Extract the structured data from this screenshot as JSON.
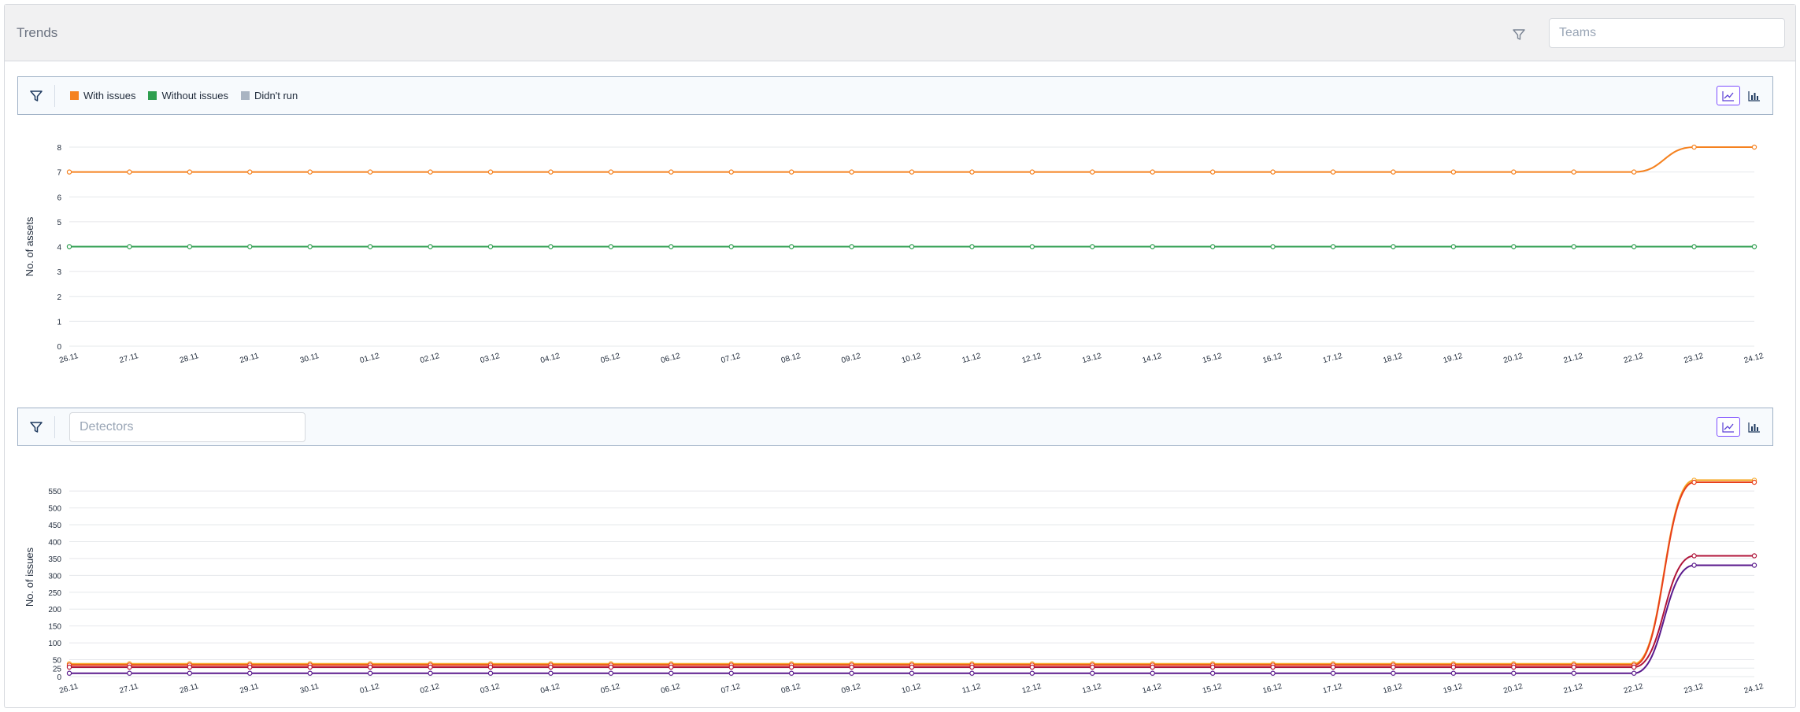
{
  "header": {
    "title": "Trends",
    "teams_placeholder": "Teams",
    "filter_icon": "filter-icon"
  },
  "assets_panel": {
    "legend": [
      {
        "label": "With issues",
        "color": "#f58220"
      },
      {
        "label": "Without issues",
        "color": "#2e9e4f"
      },
      {
        "label": "Didn't run",
        "color": "#a9b4c2"
      }
    ],
    "view_modes": [
      "line-chart-icon",
      "bar-chart-icon"
    ],
    "active_view": "line"
  },
  "issues_panel": {
    "detectors_placeholder": "Detectors",
    "view_modes": [
      "line-chart-icon",
      "bar-chart-icon"
    ],
    "active_view": "line"
  },
  "chart_data": [
    {
      "type": "line",
      "ylabel": "No. of assets",
      "xlabel": "",
      "ylim": [
        0,
        8
      ],
      "yticks": [
        0,
        1,
        2,
        3,
        4,
        5,
        6,
        7,
        8
      ],
      "grid": true,
      "categories": [
        "26.11",
        "27.11",
        "28.11",
        "29.11",
        "30.11",
        "01.12",
        "02.12",
        "03.12",
        "04.12",
        "05.12",
        "06.12",
        "07.12",
        "08.12",
        "09.12",
        "10.12",
        "11.12",
        "12.12",
        "13.12",
        "14.12",
        "15.12",
        "16.12",
        "17.12",
        "18.12",
        "19.12",
        "20.12",
        "21.12",
        "22.12",
        "23.12",
        "24.12"
      ],
      "series": [
        {
          "name": "With issues",
          "color": "#f58220",
          "values": [
            7,
            7,
            7,
            7,
            7,
            7,
            7,
            7,
            7,
            7,
            7,
            7,
            7,
            7,
            7,
            7,
            7,
            7,
            7,
            7,
            7,
            7,
            7,
            7,
            7,
            7,
            7,
            8,
            8
          ]
        },
        {
          "name": "Without issues",
          "color": "#2e9e4f",
          "values": [
            4,
            4,
            4,
            4,
            4,
            4,
            4,
            4,
            4,
            4,
            4,
            4,
            4,
            4,
            4,
            4,
            4,
            4,
            4,
            4,
            4,
            4,
            4,
            4,
            4,
            4,
            4,
            4,
            4
          ]
        }
      ]
    },
    {
      "type": "line",
      "ylabel": "No. of issues",
      "xlabel": "",
      "ylim": [
        0,
        590
      ],
      "yticks": [
        0,
        25,
        50,
        100,
        150,
        200,
        250,
        300,
        350,
        400,
        450,
        500,
        550
      ],
      "grid": true,
      "categories": [
        "26.11",
        "27.11",
        "28.11",
        "29.11",
        "30.11",
        "01.12",
        "02.12",
        "03.12",
        "04.12",
        "05.12",
        "06.12",
        "07.12",
        "08.12",
        "09.12",
        "10.12",
        "11.12",
        "12.12",
        "13.12",
        "14.12",
        "15.12",
        "16.12",
        "17.12",
        "18.12",
        "19.12",
        "20.12",
        "21.12",
        "22.12",
        "23.12",
        "24.12"
      ],
      "series": [
        {
          "color": "#f5a623",
          "values": [
            38,
            38,
            38,
            38,
            38,
            38,
            38,
            38,
            38,
            38,
            38,
            38,
            38,
            38,
            38,
            38,
            38,
            38,
            38,
            38,
            38,
            38,
            38,
            38,
            38,
            38,
            38,
            582,
            582
          ]
        },
        {
          "color": "#e8401c",
          "values": [
            34,
            34,
            34,
            34,
            34,
            34,
            34,
            34,
            34,
            34,
            34,
            34,
            34,
            34,
            34,
            34,
            34,
            34,
            34,
            34,
            34,
            34,
            34,
            34,
            34,
            34,
            34,
            576,
            576
          ]
        },
        {
          "color": "#b0153a",
          "values": [
            28,
            28,
            28,
            28,
            28,
            28,
            28,
            28,
            28,
            28,
            28,
            28,
            28,
            28,
            28,
            28,
            28,
            28,
            28,
            28,
            28,
            28,
            28,
            28,
            28,
            28,
            28,
            358,
            358
          ]
        },
        {
          "color": "#5a1a8c",
          "values": [
            10,
            10,
            10,
            10,
            10,
            10,
            10,
            10,
            10,
            10,
            10,
            10,
            10,
            10,
            10,
            10,
            10,
            10,
            10,
            10,
            10,
            10,
            10,
            10,
            10,
            10,
            10,
            330,
            330
          ]
        }
      ]
    }
  ]
}
